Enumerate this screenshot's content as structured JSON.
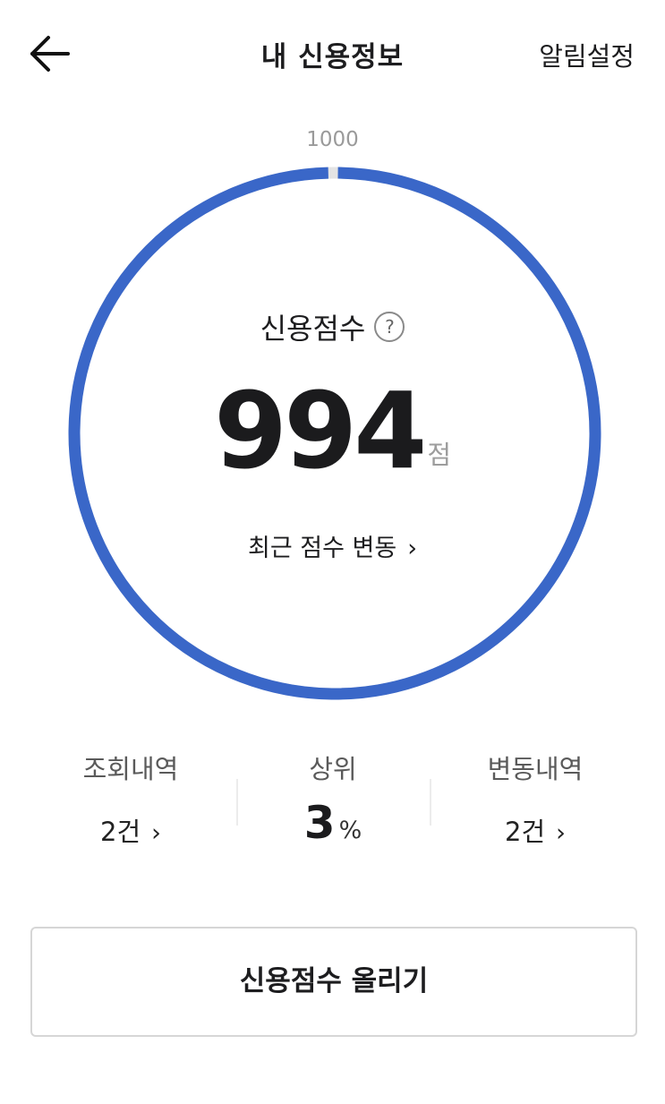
{
  "header": {
    "title": "내 신용정보",
    "settings_label": "알림설정",
    "back_icon": "arrow-left-icon"
  },
  "gauge": {
    "max_label": "1000",
    "score_label": "신용점수",
    "help_label": "?",
    "score": "994",
    "score_unit": "점",
    "fill_fraction": 0.994,
    "colors": {
      "fill": "#3a67c8",
      "track": "#e4e4e4"
    },
    "recent_label": "최근 점수 변동",
    "recent_chevron": "›"
  },
  "stats": {
    "inquiries": {
      "label": "조회내역",
      "value": "2건",
      "chevron": "›"
    },
    "rank": {
      "label": "상위",
      "value": "3",
      "unit": "%"
    },
    "changes": {
      "label": "변동내역",
      "value": "2건",
      "chevron": "›"
    }
  },
  "cta": {
    "label": "신용점수 올리기"
  }
}
